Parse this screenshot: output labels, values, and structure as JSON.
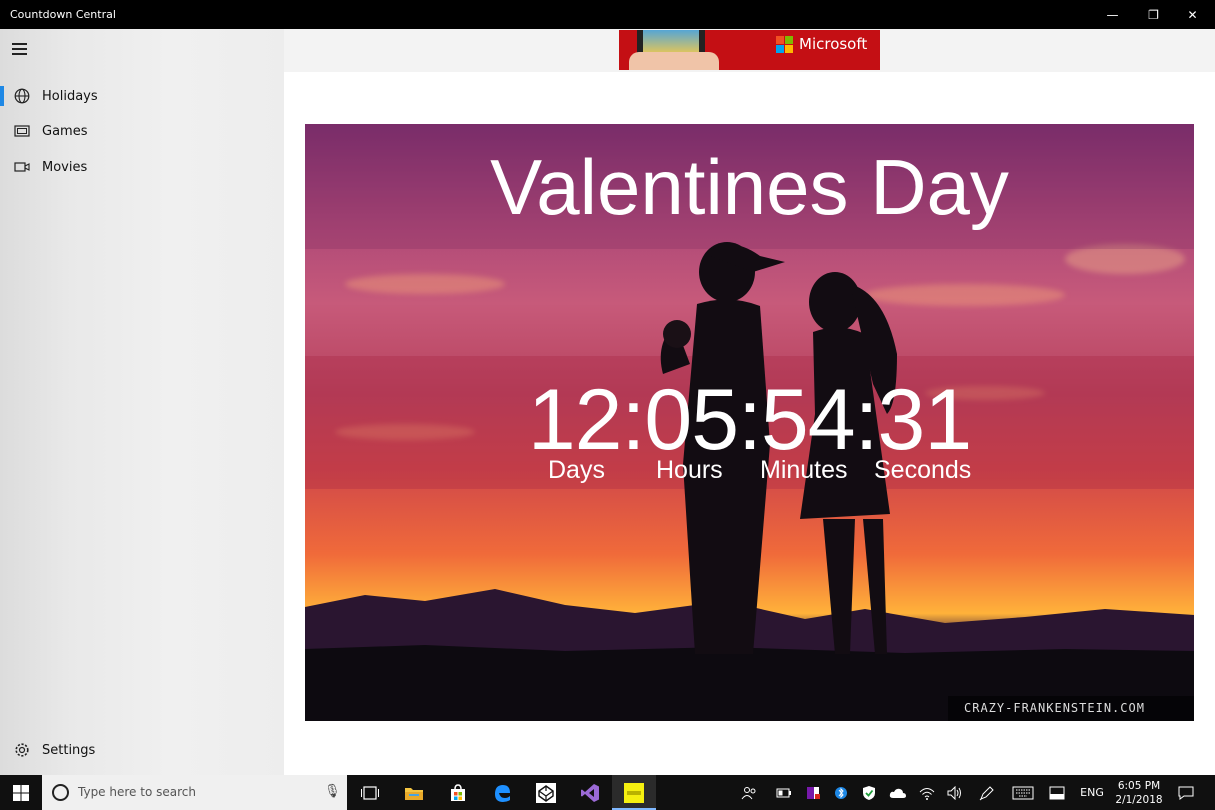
{
  "window": {
    "title": "Countdown Central",
    "minimize": "—",
    "maximize": "❐",
    "close": "✕"
  },
  "sidebar": {
    "items": [
      {
        "label": "Holidays",
        "icon": "globe-icon",
        "selected": true
      },
      {
        "label": "Games",
        "icon": "games-icon",
        "selected": false
      },
      {
        "label": "Movies",
        "icon": "video-icon",
        "selected": false
      }
    ],
    "settings_label": "Settings"
  },
  "ad": {
    "brand": "Microsoft"
  },
  "hero": {
    "title": "Valentines Day",
    "countdown": "12:05:54:31",
    "units": [
      "Days",
      "Hours",
      "Minutes",
      "Seconds"
    ],
    "watermark": "CRAZY-FRANKENSTEIN.COM"
  },
  "taskbar": {
    "search_placeholder": "Type here to search",
    "language": "ENG",
    "time": "6:05 PM",
    "date": "2/1/2018"
  },
  "colors": {
    "accent": "#1e88e5",
    "ad_red": "#c40f14"
  }
}
